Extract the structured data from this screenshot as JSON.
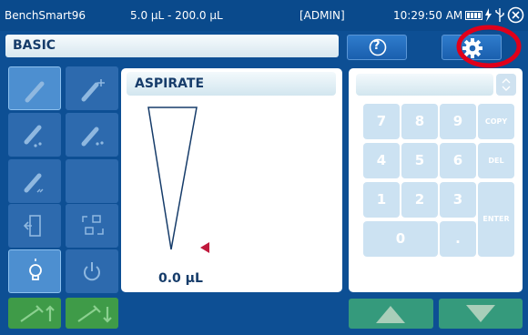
{
  "status": {
    "device": "BenchSmart96",
    "range": "5.0 µL - 200.0 µL",
    "user": "[ADMIN]",
    "time": "10:29:50 AM",
    "icons": [
      "battery-icon",
      "power-plug-icon",
      "usb-icon",
      "close-icon"
    ]
  },
  "mode": {
    "label": "BASIC"
  },
  "toolbar": {
    "help": "?",
    "settings_icon": "gear-icon"
  },
  "tools": [
    {
      "name": "aspirate-tool",
      "icon": "pipette-icon",
      "selected": true
    },
    {
      "name": "aspirate-plus-tool",
      "icon": "pipette-plus-icon"
    },
    {
      "name": "dispense-tool",
      "icon": "pipette-drops-icon"
    },
    {
      "name": "dispense-multi-tool",
      "icon": "pipette-drops-multi-icon"
    },
    {
      "name": "mix-tool",
      "icon": "pipette-mix-icon"
    },
    {
      "name": "empty-tool",
      "icon": ""
    },
    {
      "name": "door-tool",
      "icon": "door-icon"
    },
    {
      "name": "tip-tool",
      "icon": "tip-box-icon"
    },
    {
      "name": "light-tool",
      "icon": "light-bulb-icon",
      "selected": true
    },
    {
      "name": "power-tool",
      "icon": "power-icon"
    }
  ],
  "bottom_left": [
    "pipette-up-icon",
    "pipette-down-icon"
  ],
  "step": {
    "title": "ASPIRATE",
    "volume": "0.0 µL",
    "level": 0
  },
  "keypad": {
    "value": "",
    "keys": [
      "7",
      "8",
      "9",
      "COPY",
      "4",
      "5",
      "6",
      "DEL",
      "1",
      "2",
      "3",
      "ENTER",
      "0",
      "."
    ]
  },
  "nav": [
    "up-arrow-icon",
    "down-arrow-icon"
  ],
  "colors": {
    "background": "#0d4f94",
    "accent_green": "#3f9b48",
    "accent_teal": "#359a7c",
    "highlight": "#e0001a"
  }
}
